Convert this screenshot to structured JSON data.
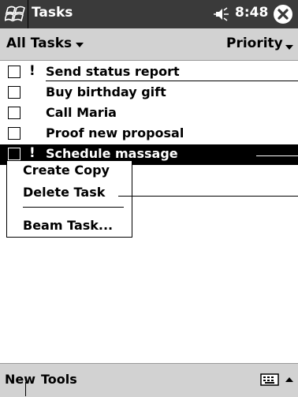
{
  "title_bar": {
    "app_title": "Tasks",
    "time": "8:48",
    "icons": {
      "start": "windows-flag-icon",
      "volume": "speaker-icon",
      "close": "close-icon"
    }
  },
  "filter_bar": {
    "category_filter": "All Tasks",
    "sort_by": "Priority"
  },
  "tasks": [
    {
      "label": "Send status report",
      "priority_mark": "!",
      "selected": false
    },
    {
      "label": "Buy birthday gift",
      "priority_mark": "",
      "selected": false
    },
    {
      "label": "Call Maria",
      "priority_mark": "",
      "selected": false
    },
    {
      "label": "Proof new proposal",
      "priority_mark": "",
      "selected": false
    },
    {
      "label": "Schedule massage",
      "priority_mark": "!",
      "selected": true
    }
  ],
  "context_menu": {
    "items": [
      "Create Copy",
      "Delete Task",
      "Beam Task..."
    ]
  },
  "bottom_bar": {
    "menu_new": "New",
    "menu_tools": "Tools",
    "icons": {
      "input": "keyboard-icon",
      "input_selector": "up-arrow-icon"
    }
  },
  "colors": {
    "title_bar": "#3a3a3a",
    "bars": "#d2d2d2",
    "selection": "#000000"
  }
}
